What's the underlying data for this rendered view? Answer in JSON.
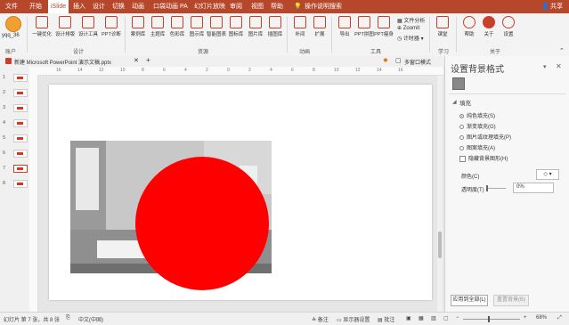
{
  "menubar": {
    "items": [
      "文件",
      "开始",
      "iSlide",
      "插入",
      "设计",
      "切换",
      "动画",
      "口袋动画 PA",
      "幻灯片放映",
      "审阅",
      "视图",
      "帮助"
    ],
    "active_index": 2,
    "search_label": "操作说明搜索",
    "share_label": "共享"
  },
  "ribbon": {
    "account": {
      "username": "yqq_36",
      "group": "账户"
    },
    "design_group": {
      "buttons": [
        "一键优化",
        "设计排版",
        "设计工具",
        "PPT诊断"
      ],
      "label": "设计"
    },
    "resources_group": {
      "buttons": [
        "案例库",
        "主题库",
        "色彩库",
        "图示库",
        "智能图表",
        "图标库",
        "图片库",
        "插图库"
      ],
      "label": "资源"
    },
    "animation_group": {
      "buttons": [
        "补间",
        "扩展"
      ],
      "label": "动画"
    },
    "tools_group": {
      "buttons": [
        "导出",
        "PPT拼图",
        "PPT瘦身"
      ],
      "small": [
        "文件分析",
        "ZoomIt",
        "计时器"
      ],
      "label": "工具"
    },
    "learn_group": {
      "buttons": [
        "课堂"
      ],
      "label": "学习"
    },
    "about_group": {
      "buttons": [
        "帮助",
        "关于",
        "设置"
      ],
      "label": "关于"
    }
  },
  "tabs": {
    "active": "新建 Microsoft PowerPoint 演示文稿.pptx",
    "right": "多窗口模式"
  },
  "ruler": {
    "labels": [
      "16",
      "14",
      "12",
      "10",
      "8",
      "6",
      "4",
      "2",
      "0",
      "2",
      "4",
      "6",
      "8",
      "10",
      "12",
      "14",
      "16"
    ]
  },
  "thumbnails": {
    "numbers": [
      "1",
      "2",
      "3",
      "4",
      "5",
      "6",
      "7",
      "8"
    ],
    "active_index": 6
  },
  "pane": {
    "title": "设置背景格式",
    "section": "填充",
    "options": [
      "纯色填充(S)",
      "渐变填充(G)",
      "图片或纹理填充(P)",
      "图案填充(A)"
    ],
    "selected_option": 0,
    "checkbox_label": "隐藏背景图形(H)",
    "color_label": "颜色(C)",
    "transparency_label": "透明度(T)",
    "transparency_value": "0%",
    "apply_all": "应用到全部(L)",
    "reset": "重置背景(B)"
  },
  "status": {
    "slide_info": "幻灯片 第 7 张，共 8 张",
    "language": "中文(中国)",
    "notes": "备注",
    "display": "显示器设置",
    "comments": "批注",
    "zoom": "68%"
  },
  "colors": {
    "brand": "#b7472a",
    "circle": "#ff0000"
  }
}
